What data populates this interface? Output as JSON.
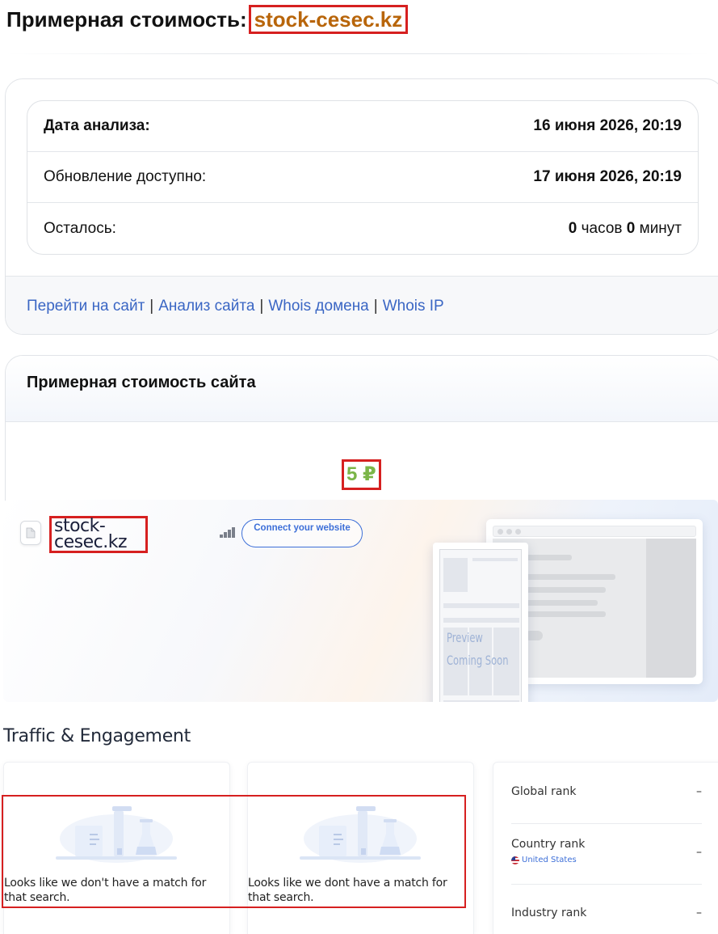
{
  "header": {
    "title_prefix": "Примерная стоимость:",
    "domain": "stock-cesec.kz"
  },
  "analysis": {
    "rows": [
      {
        "label": "Дата анализа:",
        "value": "16 июня 2026, 20:19"
      },
      {
        "label": "Обновление доступно:",
        "value": "17 июня 2026, 20:19"
      }
    ],
    "remaining": {
      "label": "Осталось:",
      "hours": "0",
      "hours_unit": "часов",
      "minutes": "0",
      "minutes_unit": "минут"
    }
  },
  "links": {
    "go_to_site": "Перейти на сайт",
    "site_analysis": "Анализ сайта",
    "whois_domain": "Whois домена",
    "whois_ip": "Whois IP",
    "separator": "|"
  },
  "valuation": {
    "title": "Примерная стоимость сайта",
    "price": "5 ₽"
  },
  "preview": {
    "site_name": "stock-cesec.kz",
    "connect_button": "Connect your website",
    "placeholder_line1": "Preview",
    "placeholder_line2": "Coming Soon"
  },
  "traffic": {
    "section_title": "Traffic & Engagement",
    "no_match_text": "Looks like we don't have a match for that search.",
    "no_match_text_2": "Looks like we dont have a match for that search.",
    "ranks": [
      {
        "label": "Global rank",
        "value": "–"
      },
      {
        "label": "Country rank",
        "value": "–",
        "country": "United States"
      },
      {
        "label": "Industry rank",
        "value": "–"
      }
    ]
  },
  "colors": {
    "highlight_border": "#d62020",
    "domain_text": "#b8650a",
    "price_text": "#7bb548",
    "link": "#3a66c4",
    "accent_blue": "#3d6fd8"
  }
}
